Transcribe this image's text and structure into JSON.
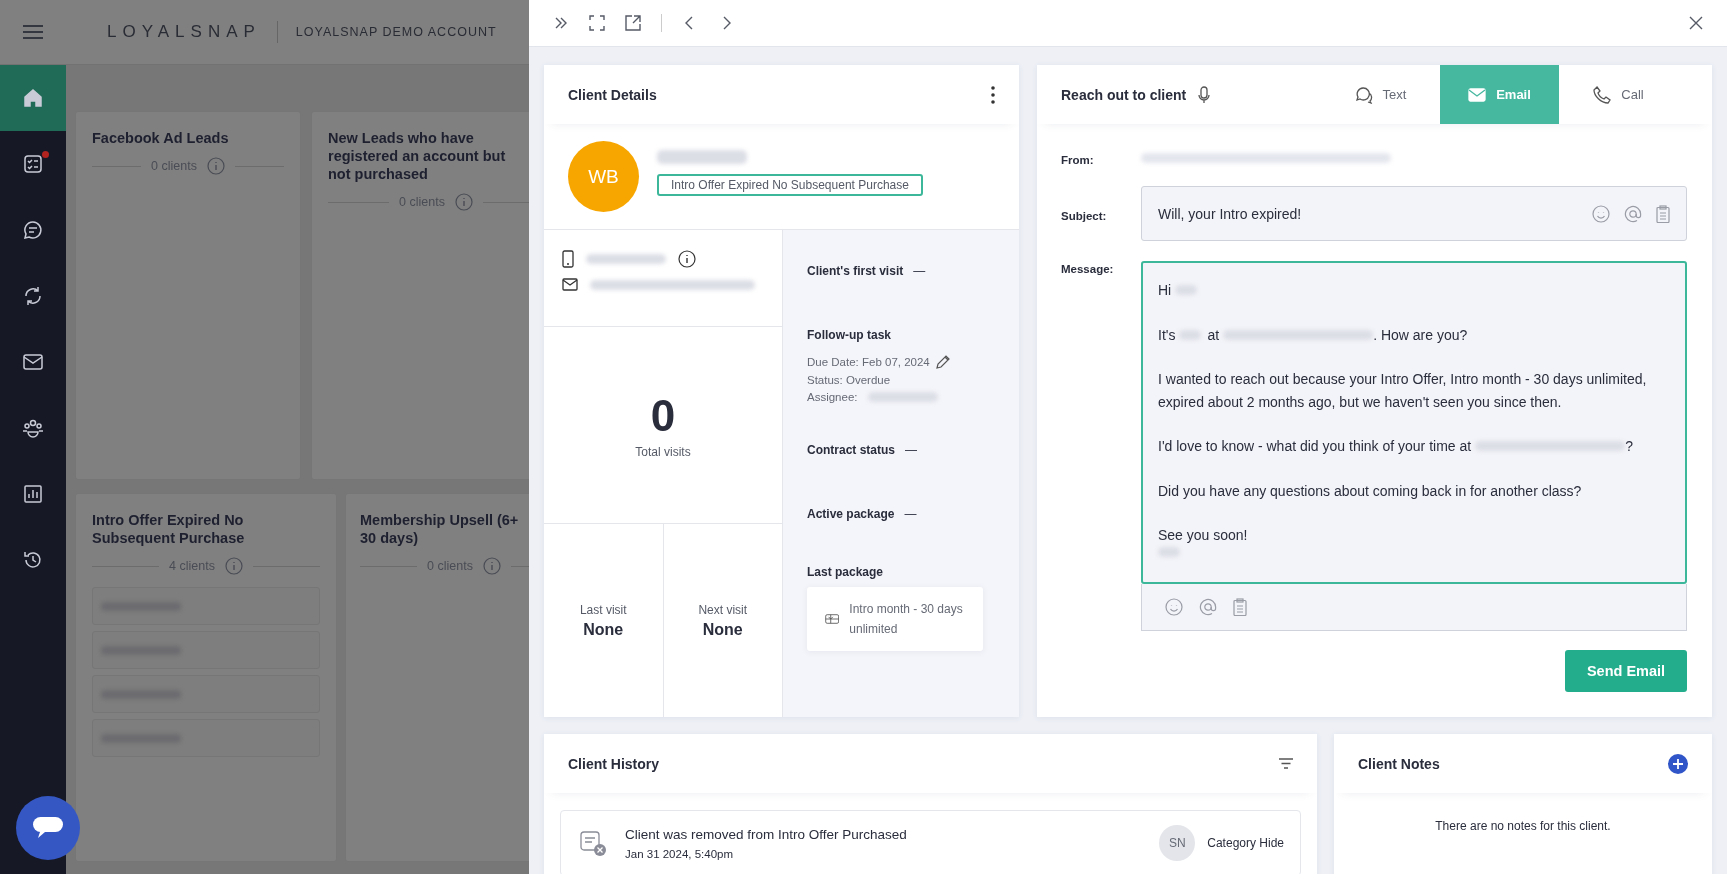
{
  "app": {
    "brand": "LOYALSNAP",
    "account": "LOYALSNAP DEMO ACCOUNT",
    "nav": [
      {
        "selected": true,
        "badge": false
      },
      {
        "selected": false,
        "badge": true
      },
      {
        "selected": false,
        "badge": false
      },
      {
        "selected": false,
        "badge": false
      },
      {
        "selected": false,
        "badge": false
      },
      {
        "selected": false,
        "badge": false
      },
      {
        "selected": false,
        "badge": false
      },
      {
        "selected": false,
        "badge": false
      }
    ],
    "segments": [
      {
        "title": "Facebook Ad Leads",
        "count": "0 clients"
      },
      {
        "title": "New Leads who have registered an account but not purchased",
        "count": "0 clients"
      },
      {
        "title": "Intro Offer Expired No Subsequent Purchase",
        "count": "4 clients",
        "clients": [
          {
            "kind": "redacted"
          },
          {
            "kind": "redacted"
          },
          {
            "kind": "redacted"
          },
          {
            "kind": "redacted"
          }
        ]
      },
      {
        "title": "Membership Upsell (6+ 30 days)",
        "count": "0 clients"
      }
    ]
  },
  "client_details": {
    "title": "Client Details",
    "initials": "WB",
    "tag": "Intro Offer Expired No Subsequent Purchase",
    "total_visits": "0",
    "total_visits_label": "Total visits",
    "visits": [
      {
        "label": "Last visit",
        "value": "None"
      },
      {
        "label": "Next visit",
        "value": "None"
      }
    ],
    "facts": [
      {
        "kind": "plain",
        "label": "Client's first visit",
        "value": "—"
      },
      {
        "kind": "task",
        "label": "Follow-up task",
        "due": "Due Date: Feb 07, 2024",
        "status": "Status: Overdue",
        "assignee": "Assignee:"
      },
      {
        "kind": "plain",
        "label": "Contract status",
        "value": "—"
      },
      {
        "kind": "plain",
        "label": "Active package",
        "value": "—"
      },
      {
        "kind": "package",
        "label": "Last package",
        "value": "Intro month - 30 days unlimited"
      }
    ]
  },
  "reach_out": {
    "title": "Reach out to client",
    "tabs": [
      {
        "label": "Text",
        "selected": false
      },
      {
        "label": "Email",
        "selected": true
      },
      {
        "label": "Call",
        "selected": false
      }
    ],
    "from_label": "From:",
    "subject_label": "Subject:",
    "subject": "Will, your Intro expired!",
    "message_label": "Message:",
    "paragraphs": [
      {
        "lines": [
          {
            "parts": [
              {
                "kind": "text",
                "text": "Hi"
              },
              {
                "kind": "redacted-name"
              }
            ]
          }
        ]
      },
      {
        "lines": [
          {
            "parts": [
              {
                "kind": "text",
                "text": "It's"
              },
              {
                "kind": "redacted-name"
              },
              {
                "kind": "text",
                "text": "at"
              },
              {
                "kind": "redacted-company"
              },
              {
                "kind": "text",
                "text": ". How are you?"
              }
            ]
          }
        ]
      },
      {
        "lines": [
          {
            "parts": [
              {
                "kind": "text",
                "text": "I wanted to reach out because your Intro Offer, Intro month - 30 days unlimited, expired about 2 months ago, but we haven't seen you since then."
              }
            ]
          }
        ]
      },
      {
        "lines": [
          {
            "parts": [
              {
                "kind": "text",
                "text": "I'd love to know - what did you think of your time at"
              },
              {
                "kind": "redacted-company"
              },
              {
                "kind": "text",
                "text": "?"
              }
            ]
          }
        ]
      },
      {
        "lines": [
          {
            "parts": [
              {
                "kind": "text",
                "text": "Did you have any questions about coming back in for another class?"
              }
            ]
          }
        ]
      },
      {
        "lines": [
          {
            "parts": [
              {
                "kind": "text",
                "text": "See you soon!"
              }
            ]
          },
          {
            "parts": [
              {
                "kind": "redacted-name"
              }
            ]
          }
        ]
      }
    ],
    "send": "Send Email"
  },
  "client_history": {
    "title": "Client History",
    "entries": [
      {
        "text": "Client was removed from Intro Offer Purchased",
        "time": "Jan 31 2024, 5:40pm",
        "initials": "SN",
        "action": "Category Hide"
      }
    ]
  },
  "client_notes": {
    "title": "Client Notes",
    "empty": "There are no notes for this client."
  }
}
